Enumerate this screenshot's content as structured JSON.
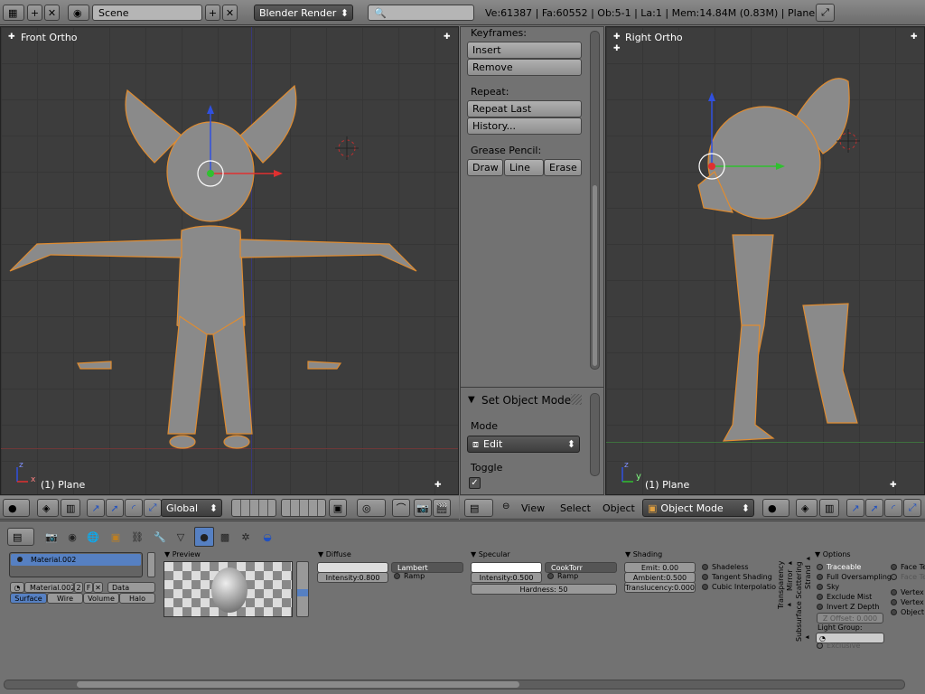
{
  "top_header": {
    "scene_label": "Scene",
    "render_engine": "Blender Render",
    "stats": "Ve:61387 | Fa:60552 | Ob:5-1 | La:1 | Mem:14.84M (0.83M) | Plane"
  },
  "viewport_left": {
    "title": "Front Ortho",
    "object_label": "(1) Plane"
  },
  "viewport_right": {
    "title": "Right Ortho",
    "object_label": "(1) Plane"
  },
  "tool_panel": {
    "keyframes_label": "Keyframes:",
    "insert": "Insert",
    "remove": "Remove",
    "repeat_label": "Repeat:",
    "repeat_last": "Repeat Last",
    "history": "History...",
    "grease_label": "Grease Pencil:",
    "draw": "Draw",
    "line": "Line",
    "erase": "Erase",
    "operator_title": "Set Object Mode",
    "mode_label": "Mode",
    "mode_value": "Edit",
    "toggle_label": "Toggle"
  },
  "viewport_header_left": {
    "orientation": "Global"
  },
  "viewport_header_right": {
    "view": "View",
    "select": "Select",
    "object": "Object",
    "mode": "Object Mode"
  },
  "properties": {
    "material_slot": "Material.002",
    "material_name": "Material.002",
    "users": "2",
    "link": "Data",
    "tabs": [
      "Surface",
      "Wire",
      "Volume",
      "Halo"
    ],
    "preview_label": "Preview",
    "diffuse": {
      "title": "Diffuse",
      "shader": "Lambert",
      "intensity": "Intensity:0.800",
      "ramp": "Ramp"
    },
    "specular": {
      "title": "Specular",
      "shader": "CookTorr",
      "intensity": "Intensity:0.500",
      "ramp": "Ramp",
      "hardness": "Hardness: 50"
    },
    "shading": {
      "title": "Shading",
      "emit": "Emit: 0.00",
      "ambient": "Ambient:0.500",
      "translucency": "Translucency:0.000",
      "shadeless": "Shadeless",
      "tangent": "Tangent Shading",
      "cubic": "Cubic Interpolatio"
    },
    "vertical_tabs": [
      "Transparency",
      "Mirror",
      "Subsurface Scattering",
      "Strand"
    ],
    "options": {
      "title": "Options",
      "traceable": "Traceable",
      "full_oversampling": "Full Oversampling",
      "sky": "Sky",
      "exclude_mist": "Exclude Mist",
      "invert_z": "Invert Z Depth",
      "z_offset": "Z Offset: 0.000",
      "light_group": "Light Group:",
      "exclusive": "Exclusive",
      "face_tex": "Face Tex",
      "face_tex2": "Face Te",
      "vertex_col": "Vertex C",
      "vertex_col2": "Vertex C",
      "object_col": "Object"
    }
  },
  "colors": {
    "selected_blue": "#5680c2",
    "axis_red": "#e03030",
    "axis_green": "#30c030",
    "axis_blue": "#3050e0",
    "outline_orange": "#e08c30"
  }
}
